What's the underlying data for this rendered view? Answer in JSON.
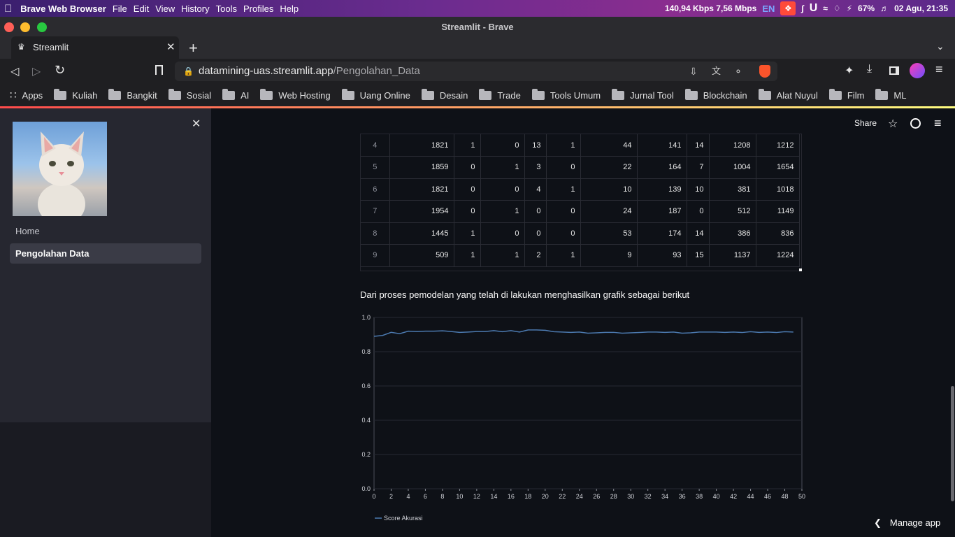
{
  "os_menubar": {
    "app_name": "Brave Web Browser",
    "menus": [
      "File",
      "Edit",
      "View",
      "History",
      "Tools",
      "Profiles",
      "Help"
    ],
    "net_speed": "140,94 Kbps 7,56 Mbps",
    "lang": "EN",
    "battery": "67%",
    "datetime": "02 Agu, 21:35"
  },
  "window": {
    "title": "Streamlit - Brave"
  },
  "tab": {
    "title": "Streamlit"
  },
  "address": {
    "host": "datamining-uas.streamlit.app",
    "path": "/Pengolahan_Data"
  },
  "bookmarks": [
    {
      "label": "Apps",
      "icon": "grid-icon"
    },
    {
      "label": "Kuliah"
    },
    {
      "label": "Bangkit"
    },
    {
      "label": "Sosial"
    },
    {
      "label": "AI"
    },
    {
      "label": "Web Hosting"
    },
    {
      "label": "Uang Online"
    },
    {
      "label": "Desain"
    },
    {
      "label": "Trade"
    },
    {
      "label": "Tools Umum"
    },
    {
      "label": "Jurnal Tool"
    },
    {
      "label": "Blockchain"
    },
    {
      "label": "Alat Nuyul"
    },
    {
      "label": "Film"
    },
    {
      "label": "ML"
    }
  ],
  "header": {
    "share_label": "Share",
    "manage_app": "Manage app"
  },
  "sidebar": {
    "items": [
      {
        "label": "Home",
        "active": false
      },
      {
        "label": "Pengolahan Data",
        "active": true
      }
    ]
  },
  "table": {
    "rows": [
      [
        "4",
        "1821",
        "1",
        "0",
        "13",
        "1",
        "44",
        "141",
        "14",
        "1208",
        "1212"
      ],
      [
        "5",
        "1859",
        "0",
        "1",
        "3",
        "0",
        "22",
        "164",
        "7",
        "1004",
        "1654"
      ],
      [
        "6",
        "1821",
        "0",
        "0",
        "4",
        "1",
        "10",
        "139",
        "10",
        "381",
        "1018"
      ],
      [
        "7",
        "1954",
        "0",
        "1",
        "0",
        "0",
        "24",
        "187",
        "0",
        "512",
        "1149"
      ],
      [
        "8",
        "1445",
        "1",
        "0",
        "0",
        "0",
        "53",
        "174",
        "14",
        "386",
        "836"
      ],
      [
        "9",
        "509",
        "1",
        "1",
        "2",
        "1",
        "9",
        "93",
        "15",
        "1137",
        "1224"
      ]
    ]
  },
  "caption": "Dari proses pemodelan yang telah di lakukan menghasilkan grafik sebagai berikut",
  "colors": {
    "line": "#4c7ab0",
    "accent": "#ff4b4b",
    "sidebar": "#262730",
    "bg": "#0e1117"
  },
  "chart_data": {
    "type": "line",
    "title": "",
    "xlabel": "",
    "ylabel": "",
    "xlim": [
      0,
      50
    ],
    "ylim": [
      0.0,
      1.0
    ],
    "x_ticks": [
      "0",
      "2",
      "4",
      "6",
      "8",
      "10",
      "12",
      "14",
      "16",
      "18",
      "20",
      "22",
      "24",
      "26",
      "28",
      "30",
      "32",
      "34",
      "36",
      "38",
      "40",
      "42",
      "44",
      "46",
      "48",
      "50"
    ],
    "y_ticks": [
      "0.0",
      "0.2",
      "0.4",
      "0.6",
      "0.8",
      "1.0"
    ],
    "grid": true,
    "legend_position": "bottom-left",
    "series": [
      {
        "name": "Score Akurasi",
        "x": [
          0,
          1,
          2,
          3,
          4,
          5,
          6,
          7,
          8,
          9,
          10,
          11,
          12,
          13,
          14,
          15,
          16,
          17,
          18,
          19,
          20,
          21,
          22,
          23,
          24,
          25,
          26,
          27,
          28,
          29,
          30,
          31,
          32,
          33,
          34,
          35,
          36,
          37,
          38,
          39,
          40,
          41,
          42,
          43,
          44,
          45,
          46,
          47,
          48,
          49
        ],
        "values": [
          0.89,
          0.895,
          0.913,
          0.905,
          0.92,
          0.918,
          0.92,
          0.92,
          0.922,
          0.918,
          0.913,
          0.915,
          0.918,
          0.918,
          0.923,
          0.917,
          0.923,
          0.915,
          0.927,
          0.927,
          0.925,
          0.917,
          0.915,
          0.913,
          0.915,
          0.908,
          0.91,
          0.913,
          0.913,
          0.908,
          0.91,
          0.912,
          0.915,
          0.915,
          0.913,
          0.915,
          0.908,
          0.91,
          0.915,
          0.915,
          0.915,
          0.913,
          0.915,
          0.912,
          0.917,
          0.913,
          0.915,
          0.912,
          0.917,
          0.915
        ]
      }
    ]
  }
}
